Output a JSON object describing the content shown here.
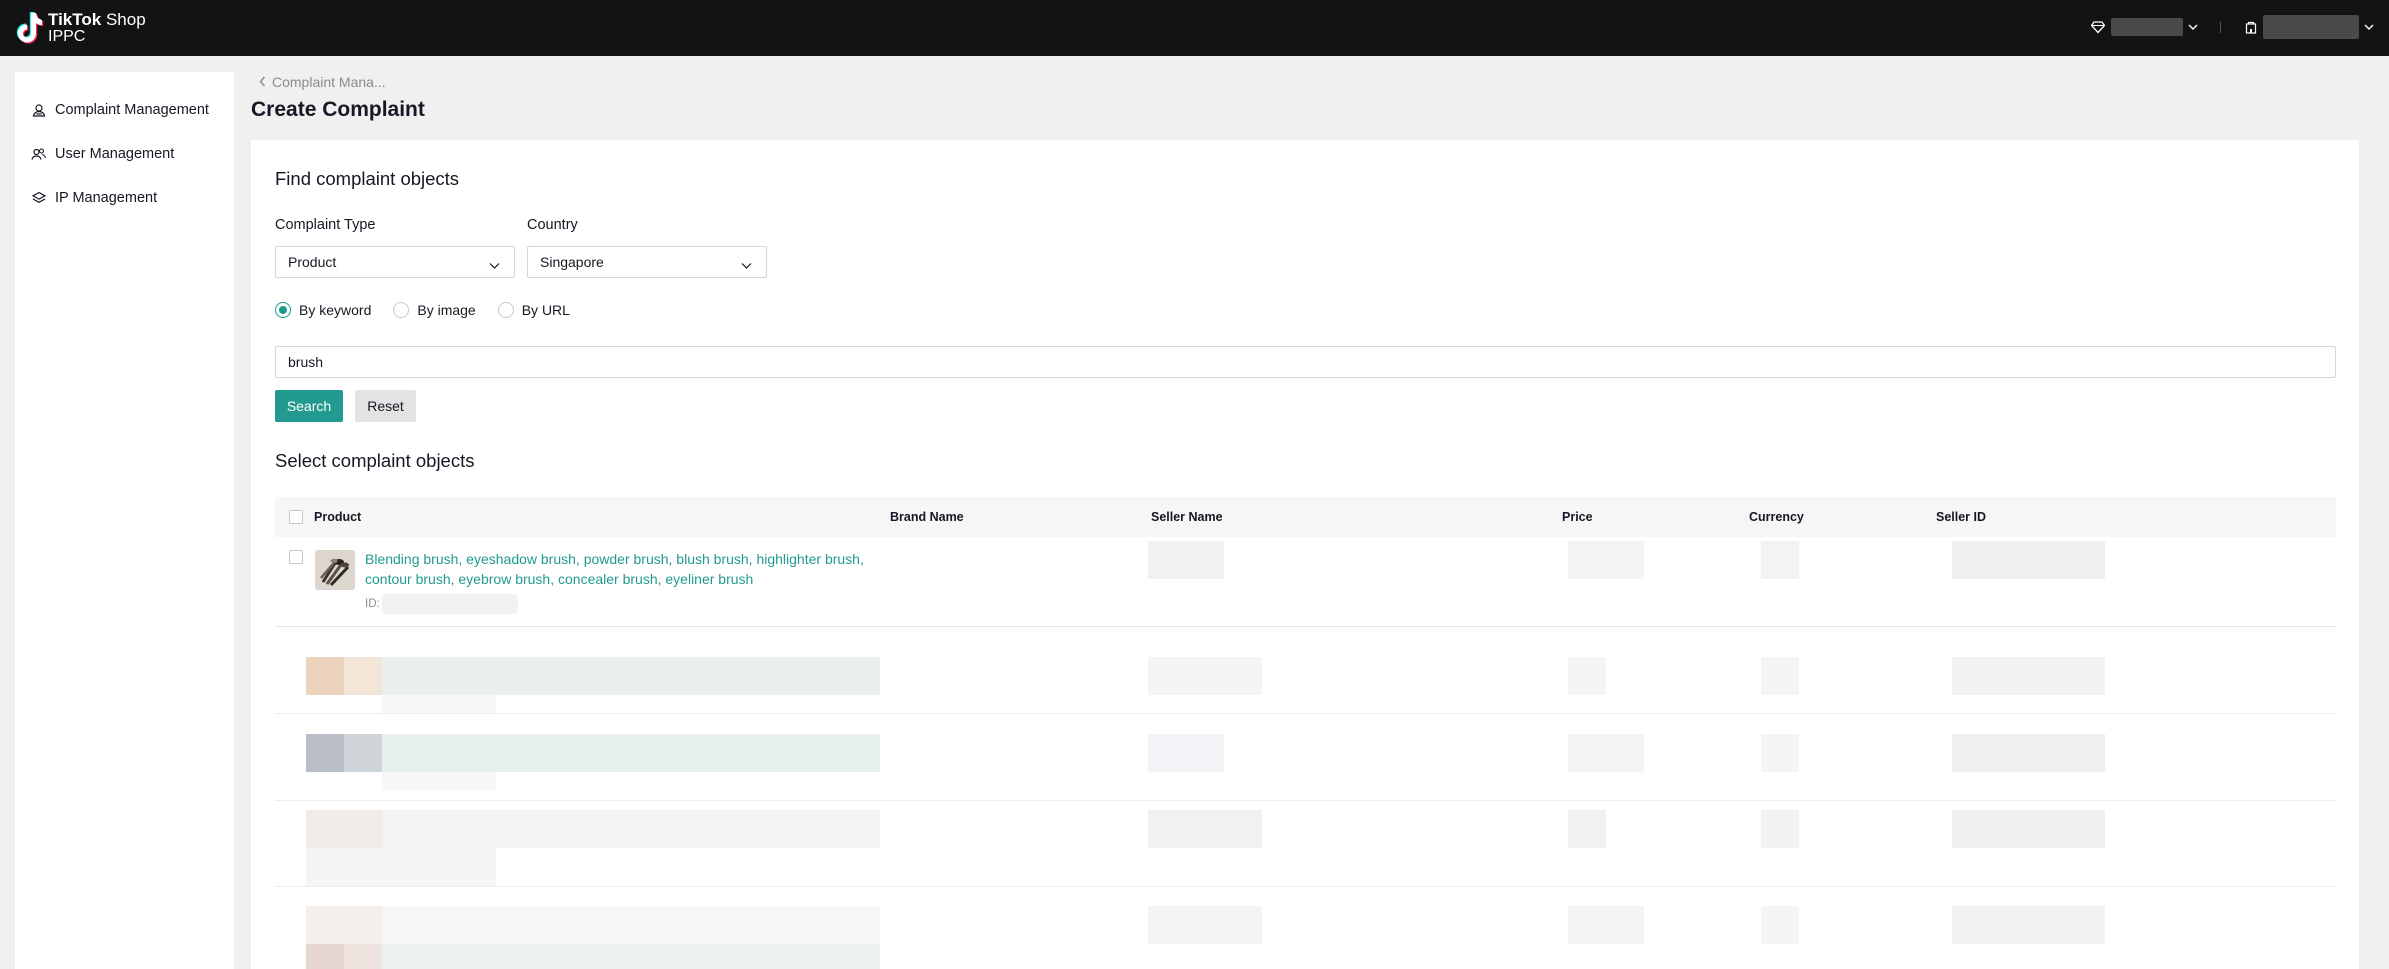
{
  "app": {
    "logo_line1_bold": "TikTok",
    "logo_line1_rest": " Shop",
    "logo_line2": "IPPC"
  },
  "sidebar": {
    "items": [
      {
        "label": "Complaint Management",
        "icon": "complaint-icon"
      },
      {
        "label": "User Management",
        "icon": "users-icon"
      },
      {
        "label": "IP Management",
        "icon": "layers-icon"
      }
    ]
  },
  "header": {
    "breadcrumb": "Complaint Mana...",
    "title": "Create Complaint"
  },
  "find": {
    "title": "Find complaint objects",
    "complaint_type_label": "Complaint Type",
    "complaint_type_value": "Product",
    "country_label": "Country",
    "country_value": "Singapore",
    "search_modes": [
      "By keyword",
      "By image",
      "By URL"
    ],
    "selected_mode": "By keyword",
    "keyword": "brush",
    "search_label": "Search",
    "reset_label": "Reset"
  },
  "select": {
    "title": "Select complaint objects",
    "columns": [
      "Product",
      "Brand Name",
      "Seller Name",
      "Price",
      "Currency",
      "Seller ID"
    ],
    "rows": [
      {
        "product": "Blending brush, eyeshadow brush, powder brush, blush brush, highlighter brush, contour brush, eyebrow brush, concealer brush, eyeliner brush",
        "id_label": "ID:"
      }
    ]
  },
  "colors": {
    "accent": "#229a8f",
    "topbar": "#131313"
  }
}
